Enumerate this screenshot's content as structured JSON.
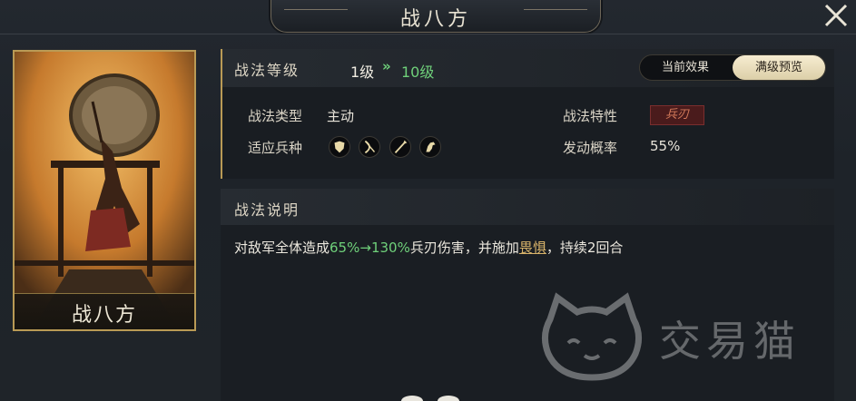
{
  "header": {
    "title": "战八方"
  },
  "card": {
    "name": "战八方"
  },
  "level": {
    "label": "战法等级",
    "current": "1级",
    "arrow": "»",
    "max": "10级"
  },
  "tabs": {
    "current_effect": "当前效果",
    "max_preview": "满级预览",
    "selected": "满级预览"
  },
  "attrs": {
    "type_label": "战法类型",
    "type_value": "主动",
    "troops_label": "适应兵种",
    "trait_label": "战法特性",
    "trait_value": "兵刃",
    "chance_label": "发动概率",
    "chance_value": "55%"
  },
  "troop_icons": [
    "shield-icon",
    "bow-icon",
    "spear-icon",
    "horse-icon"
  ],
  "description": {
    "label": "战法说明",
    "part1": "对敌军全体造成",
    "dmg_from": "65%",
    "arrow": "→",
    "dmg_to": "130%",
    "part2": "兵刃伤害，并施加",
    "status": "畏惧",
    "part3": "，持续2回合"
  },
  "watermark": {
    "text": "交易猫"
  },
  "colors": {
    "accent_green": "#6fd07a",
    "gold_border": "#b99a55",
    "badge_red": "#4a1b1c"
  }
}
